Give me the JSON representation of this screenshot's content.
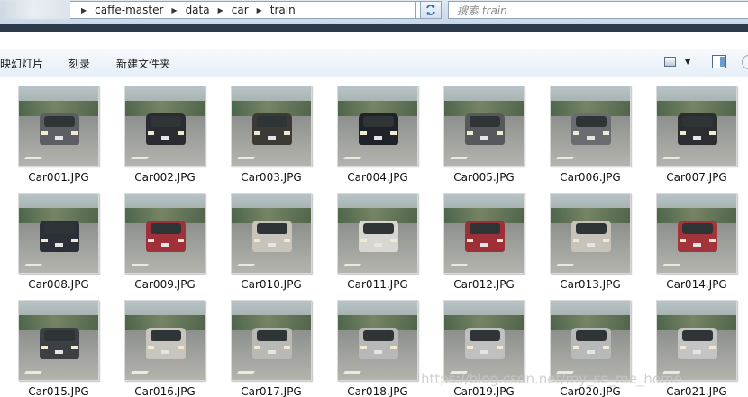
{
  "address": {
    "path": [
      "caffe-master",
      "data",
      "car",
      "train"
    ]
  },
  "search": {
    "placeholder": "搜索 train"
  },
  "command_bar": {
    "slideshow": "映幻灯片",
    "burn": "刻录",
    "new_folder": "新建文件夹"
  },
  "files": [
    {
      "name": "Car001.JPG",
      "car_color": "#5b5f63"
    },
    {
      "name": "Car002.JPG",
      "car_color": "#2a2c32"
    },
    {
      "name": "Car003.JPG",
      "car_color": "#3c3a35"
    },
    {
      "name": "Car004.JPG",
      "car_color": "#1f2228"
    },
    {
      "name": "Car005.JPG",
      "car_color": "#55595c"
    },
    {
      "name": "Car006.JPG",
      "car_color": "#6a6d70"
    },
    {
      "name": "Car007.JPG",
      "car_color": "#2b2d31"
    },
    {
      "name": "Car008.JPG",
      "car_color": "#2d2f38"
    },
    {
      "name": "Car009.JPG",
      "car_color": "#a0303a"
    },
    {
      "name": "Car010.JPG",
      "car_color": "#c9c4bb"
    },
    {
      "name": "Car011.JPG",
      "car_color": "#d8d6d0"
    },
    {
      "name": "Car012.JPG",
      "car_color": "#9e2f36"
    },
    {
      "name": "Car013.JPG",
      "car_color": "#c7c3ba"
    },
    {
      "name": "Car014.JPG",
      "car_color": "#a3343b"
    },
    {
      "name": "Car015.JPG",
      "car_color": "#3c3f44"
    },
    {
      "name": "Car016.JPG",
      "car_color": "#c8c5be"
    },
    {
      "name": "Car017.JPG",
      "car_color": "#b9b9b5"
    },
    {
      "name": "Car018.JPG",
      "car_color": "#b8b8b8"
    },
    {
      "name": "Car019.JPG",
      "car_color": "#c0c0c0"
    },
    {
      "name": "Car020.JPG",
      "car_color": "#b8b9ba"
    },
    {
      "name": "Car021.JPG",
      "car_color": "#c4c4c4"
    }
  ],
  "watermark": "https://blog.csdn.net/my_se_me_home"
}
